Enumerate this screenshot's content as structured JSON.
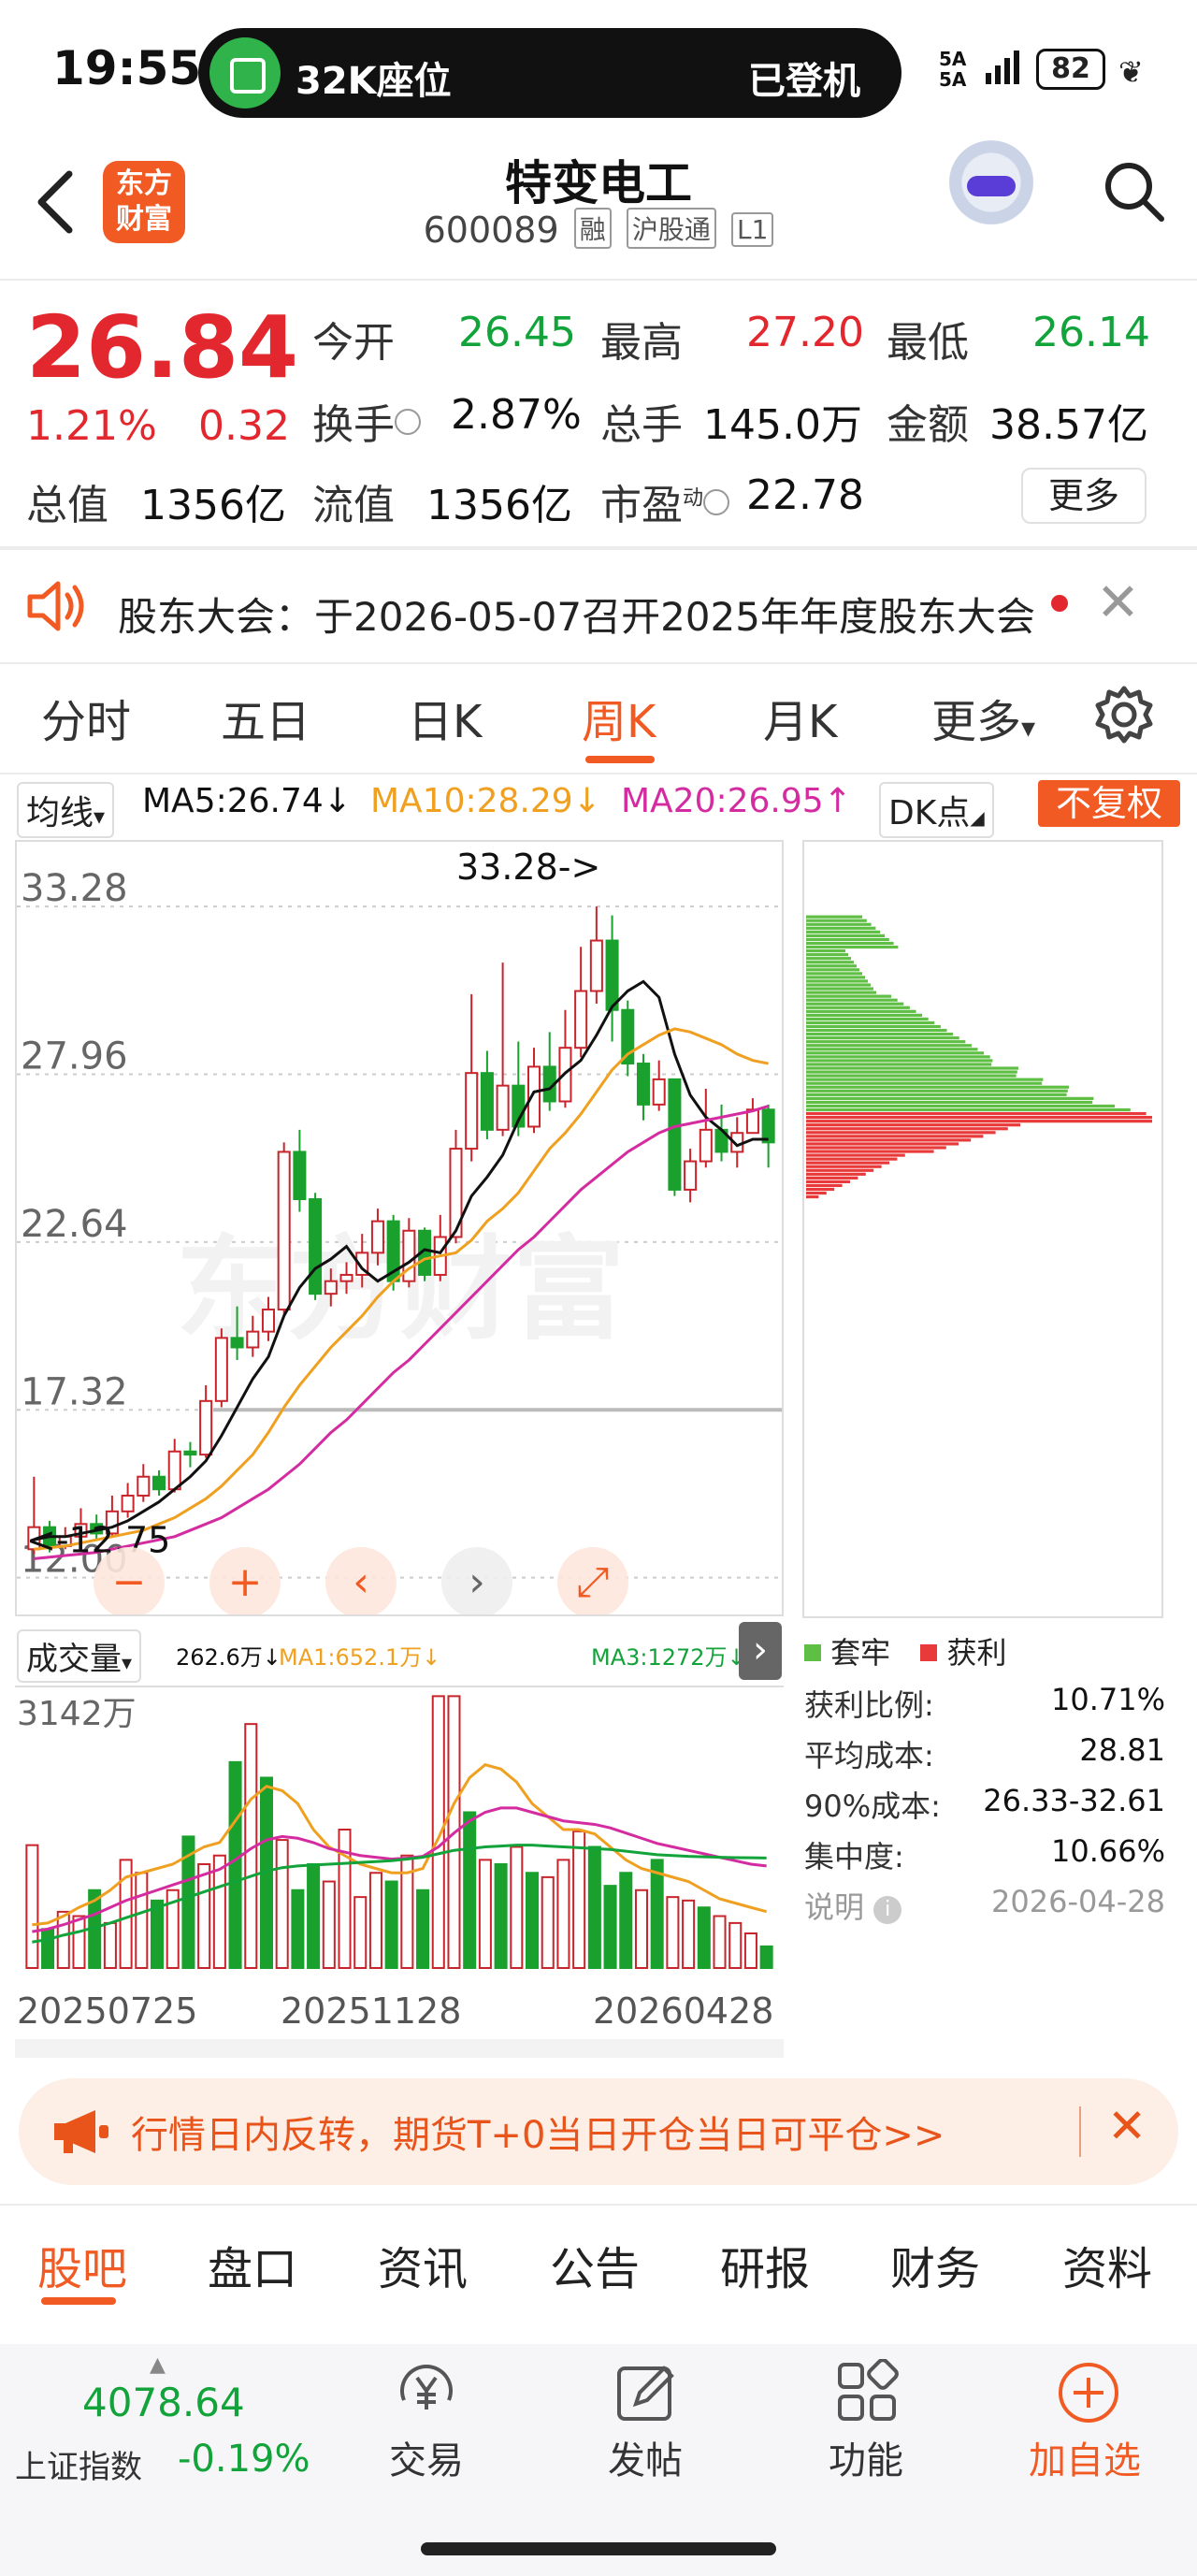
{
  "status_bar": {
    "time": "19:55",
    "island_left": "32K座位",
    "island_right": "已登机",
    "signal_top": "5A",
    "signal_bottom": "5A",
    "battery": "82"
  },
  "header": {
    "logo_text_1": "东方",
    "logo_text_2": "财富",
    "title": "特变电工",
    "code": "600089",
    "tags": [
      "融",
      "沪股通",
      "L1"
    ]
  },
  "quote": {
    "price": "26.84",
    "change_pct": "1.21%",
    "change": "0.32",
    "rows": [
      [
        {
          "label": "今开",
          "value": "26.45",
          "color": "green"
        },
        {
          "label": "最高",
          "value": "27.20",
          "color": "red"
        },
        {
          "label": "最低",
          "value": "26.14",
          "color": "green"
        }
      ],
      [
        {
          "label": "换手",
          "value": "2.87%",
          "color": "black"
        },
        {
          "label": "总手",
          "value": "145.0万",
          "color": "black"
        },
        {
          "label": "金额",
          "value": "38.57亿",
          "color": "black"
        }
      ],
      [
        {
          "label": "总值",
          "value": "1356亿",
          "color": "black"
        },
        {
          "label": "流值",
          "value": "1356亿",
          "color": "black"
        },
        {
          "label": "市盈",
          "value": "22.78",
          "color": "black"
        }
      ]
    ],
    "pe_superscript": "动",
    "more_label": "更多"
  },
  "notice": {
    "text": "股东大会：于2026-05-07召开2025年年度股东大会"
  },
  "tabs": [
    "分时",
    "五日",
    "日K",
    "周K",
    "月K",
    "更多"
  ],
  "active_tab": "周K",
  "ma_bar": {
    "selector": "均线",
    "ma5": "MA5:26.74↓",
    "ma10": "MA10:28.29↓",
    "ma20": "MA20:26.95↑",
    "dk": "DK点",
    "adjust": "不复权",
    "colors": {
      "ma5": "#111111",
      "ma10": "#f0a020",
      "ma20": "#d42ca0"
    }
  },
  "kline": {
    "y_labels": [
      "33.28",
      "27.96",
      "22.64",
      "17.32",
      "12.00"
    ],
    "high_annotation": "33.28->",
    "low_annotation": "<-12.75",
    "watermark": "东方财富",
    "up_color": "#c8242b",
    "down_color": "#1aa02c",
    "candles": [
      [
        12.9,
        13.6,
        12.75,
        15.2
      ],
      [
        13.6,
        13.0,
        12.8,
        13.8
      ],
      [
        13.0,
        13.3,
        12.9,
        13.6
      ],
      [
        13.3,
        13.7,
        13.1,
        14.2
      ],
      [
        13.7,
        13.4,
        13.2,
        14.0
      ],
      [
        13.4,
        14.1,
        13.3,
        14.6
      ],
      [
        14.1,
        14.6,
        13.9,
        15.0
      ],
      [
        14.6,
        15.2,
        14.4,
        15.6
      ],
      [
        15.2,
        14.8,
        14.6,
        15.4
      ],
      [
        14.8,
        16.0,
        14.7,
        16.4
      ],
      [
        16.0,
        15.9,
        15.5,
        16.3
      ],
      [
        15.9,
        17.6,
        15.8,
        18.1
      ],
      [
        17.6,
        19.6,
        17.4,
        19.9
      ],
      [
        19.6,
        19.3,
        18.9,
        20.6
      ],
      [
        19.3,
        19.8,
        19.0,
        20.3
      ],
      [
        19.8,
        20.5,
        19.5,
        20.9
      ],
      [
        20.5,
        25.5,
        20.3,
        25.8
      ],
      [
        25.5,
        24.0,
        23.6,
        26.2
      ],
      [
        24.0,
        21.0,
        20.8,
        24.2
      ],
      [
        21.0,
        21.4,
        20.6,
        21.8
      ],
      [
        21.4,
        21.6,
        21.0,
        22.0
      ],
      [
        21.6,
        22.3,
        21.2,
        22.9
      ],
      [
        22.3,
        23.3,
        21.9,
        23.7
      ],
      [
        23.3,
        21.4,
        21.1,
        23.5
      ],
      [
        21.4,
        23.0,
        21.2,
        23.4
      ],
      [
        23.0,
        21.6,
        21.4,
        23.1
      ],
      [
        21.6,
        22.8,
        21.4,
        23.5
      ],
      [
        22.8,
        25.6,
        22.6,
        26.2
      ],
      [
        25.6,
        28.0,
        25.2,
        30.5
      ],
      [
        28.0,
        26.2,
        25.9,
        28.7
      ],
      [
        26.2,
        27.6,
        26.0,
        31.5
      ],
      [
        27.6,
        26.3,
        26.0,
        29.0
      ],
      [
        26.3,
        28.2,
        26.1,
        28.8
      ],
      [
        28.2,
        27.1,
        26.8,
        29.3
      ],
      [
        27.1,
        28.8,
        26.9,
        30.0
      ],
      [
        28.8,
        30.6,
        28.5,
        32.0
      ],
      [
        30.6,
        32.2,
        30.2,
        33.28
      ],
      [
        32.2,
        30.0,
        29.0,
        33.0
      ],
      [
        30.0,
        28.3,
        27.9,
        30.3
      ],
      [
        28.3,
        27.0,
        26.5,
        28.6
      ],
      [
        27.0,
        27.8,
        26.8,
        28.4
      ],
      [
        27.8,
        24.3,
        24.1,
        27.8
      ],
      [
        24.3,
        25.2,
        23.9,
        25.6
      ],
      [
        25.2,
        26.2,
        25.0,
        27.5
      ],
      [
        26.2,
        25.5,
        25.2,
        27.0
      ],
      [
        25.5,
        26.1,
        25.0,
        26.6
      ],
      [
        26.1,
        26.84,
        26.14,
        27.2
      ],
      [
        26.84,
        25.8,
        25.0,
        27.0
      ]
    ],
    "ma5": [
      13.2,
      13.3,
      13.3,
      13.4,
      13.5,
      13.6,
      13.8,
      14.1,
      14.4,
      14.8,
      15.2,
      15.7,
      16.5,
      17.4,
      18.3,
      19.0,
      20.3,
      21.2,
      21.8,
      22.1,
      22.5,
      21.8,
      21.4,
      21.7,
      22.0,
      22.4,
      22.3,
      23.0,
      24.1,
      24.7,
      25.4,
      26.5,
      27.4,
      27.5,
      28.0,
      28.4,
      29.2,
      30.1,
      30.6,
      30.9,
      30.4,
      28.6,
      27.3,
      26.6,
      26.2,
      25.7,
      25.9,
      25.9
    ],
    "ma10": [
      12.9,
      12.95,
      13.0,
      13.1,
      13.2,
      13.3,
      13.4,
      13.5,
      13.7,
      13.9,
      14.2,
      14.5,
      14.9,
      15.4,
      15.9,
      16.6,
      17.4,
      18.1,
      18.7,
      19.3,
      19.8,
      20.3,
      20.9,
      21.4,
      21.8,
      22.1,
      22.2,
      22.3,
      22.7,
      23.3,
      23.7,
      24.2,
      24.9,
      25.6,
      26.1,
      26.7,
      27.4,
      28.1,
      28.6,
      28.9,
      29.2,
      29.4,
      29.3,
      29.1,
      28.9,
      28.6,
      28.4,
      28.3
    ],
    "ma20": [
      12.6,
      12.65,
      12.7,
      12.75,
      12.8,
      12.9,
      13.0,
      13.1,
      13.2,
      13.3,
      13.5,
      13.7,
      13.9,
      14.2,
      14.5,
      14.8,
      15.2,
      15.6,
      16.1,
      16.6,
      17.0,
      17.5,
      18.0,
      18.5,
      18.9,
      19.4,
      19.9,
      20.4,
      20.9,
      21.4,
      21.9,
      22.4,
      22.8,
      23.3,
      23.8,
      24.3,
      24.7,
      25.1,
      25.5,
      25.8,
      26.1,
      26.3,
      26.4,
      26.5,
      26.6,
      26.7,
      26.8,
      26.95
    ],
    "support_line": 17.32,
    "controls": [
      "minus",
      "plus",
      "prev",
      "next",
      "expand"
    ]
  },
  "volume": {
    "selector": "成交量",
    "vol": "262.6万↓",
    "ma1": "MA1:652.1万↓",
    "ma3": "MA3:1272万↓",
    "max_label": "3142万",
    "ma1_color": "#f0a020",
    "ma3_color": "#12a33a",
    "ma_other_color": "#d42ca0",
    "bars": [
      1420,
      450,
      650,
      600,
      900,
      520,
      1250,
      1100,
      780,
      900,
      1520,
      1200,
      1300,
      2380,
      2820,
      2200,
      1480,
      900,
      1200,
      1000,
      1600,
      820,
      1100,
      1000,
      1300,
      900,
      3142,
      3142,
      1800,
      1250,
      1200,
      1400,
      1100,
      1050,
      1250,
      1580,
      1400,
      950,
      1100,
      900,
      1250,
      820,
      780,
      700,
      600,
      520,
      400,
      250
    ],
    "up": [
      1,
      0,
      1,
      1,
      0,
      1,
      1,
      1,
      0,
      1,
      0,
      1,
      1,
      0,
      1,
      0,
      1,
      0,
      0,
      1,
      1,
      1,
      1,
      0,
      1,
      0,
      1,
      1,
      0,
      1,
      0,
      1,
      0,
      1,
      1,
      1,
      0,
      0,
      0,
      1,
      0,
      1,
      1,
      0,
      1,
      1,
      1,
      0
    ],
    "ma1_line": [
      500,
      520,
      600,
      700,
      780,
      900,
      1050,
      1100,
      1150,
      1200,
      1300,
      1400,
      1450,
      1700,
      1950,
      2100,
      2050,
      1900,
      1600,
      1400,
      1300,
      1200,
      1150,
      1100,
      1100,
      1150,
      1500,
      1900,
      2200,
      2350,
      2300,
      2150,
      1900,
      1750,
      1600,
      1600,
      1550,
      1400,
      1250,
      1150,
      1100,
      1050,
      1000,
      900,
      800,
      750,
      700,
      652
    ],
    "ma3_line": [
      300,
      330,
      380,
      420,
      470,
      520,
      580,
      640,
      700,
      760,
      820,
      880,
      940,
      1000,
      1060,
      1120,
      1160,
      1180,
      1190,
      1200,
      1210,
      1220,
      1230,
      1240,
      1260,
      1280,
      1320,
      1360,
      1380,
      1400,
      1410,
      1420,
      1420,
      1410,
      1400,
      1390,
      1380,
      1370,
      1350,
      1330,
      1310,
      1300,
      1290,
      1285,
      1280,
      1276,
      1274,
      1272
    ],
    "ma_mid_line": [
      420,
      450,
      500,
      560,
      620,
      700,
      780,
      840,
      900,
      960,
      1020,
      1080,
      1140,
      1250,
      1380,
      1480,
      1520,
      1500,
      1450,
      1380,
      1340,
      1300,
      1280,
      1260,
      1270,
      1290,
      1400,
      1560,
      1700,
      1800,
      1850,
      1850,
      1800,
      1750,
      1700,
      1680,
      1660,
      1620,
      1560,
      1500,
      1440,
      1400,
      1360,
      1320,
      1280,
      1240,
      1200,
      1180
    ]
  },
  "dates": [
    "20250725",
    "20251128",
    "20260428"
  ],
  "chips": {
    "legend_trapped": "套牢",
    "legend_profit": "获利",
    "trapped_color": "#5fbe44",
    "profit_color": "#e83a3a",
    "rows": [
      {
        "label": "获利比例:",
        "value": "10.71%"
      },
      {
        "label": "平均成本:",
        "value": "28.81"
      },
      {
        "label": "90%成本:",
        "value": "26.33-32.61"
      },
      {
        "label": "集中度:",
        "value": "10.66%"
      },
      {
        "label": "说明",
        "value": "2026-04-28"
      }
    ]
  },
  "promo": {
    "text": "行情日内反转，期货T+0当日开仓当日可平仓>>"
  },
  "bottom_tabs": [
    "股吧",
    "盘口",
    "资讯",
    "公告",
    "研报",
    "财务",
    "资料"
  ],
  "footer": {
    "index_value": "4078.64",
    "index_name": "上证指数",
    "index_change": "-0.19%",
    "items": [
      {
        "label": "交易",
        "icon": "yen-icon"
      },
      {
        "label": "发帖",
        "icon": "edit-icon"
      },
      {
        "label": "功能",
        "icon": "grid-icon"
      },
      {
        "label": "加自选",
        "icon": "add-circle-icon"
      }
    ]
  }
}
